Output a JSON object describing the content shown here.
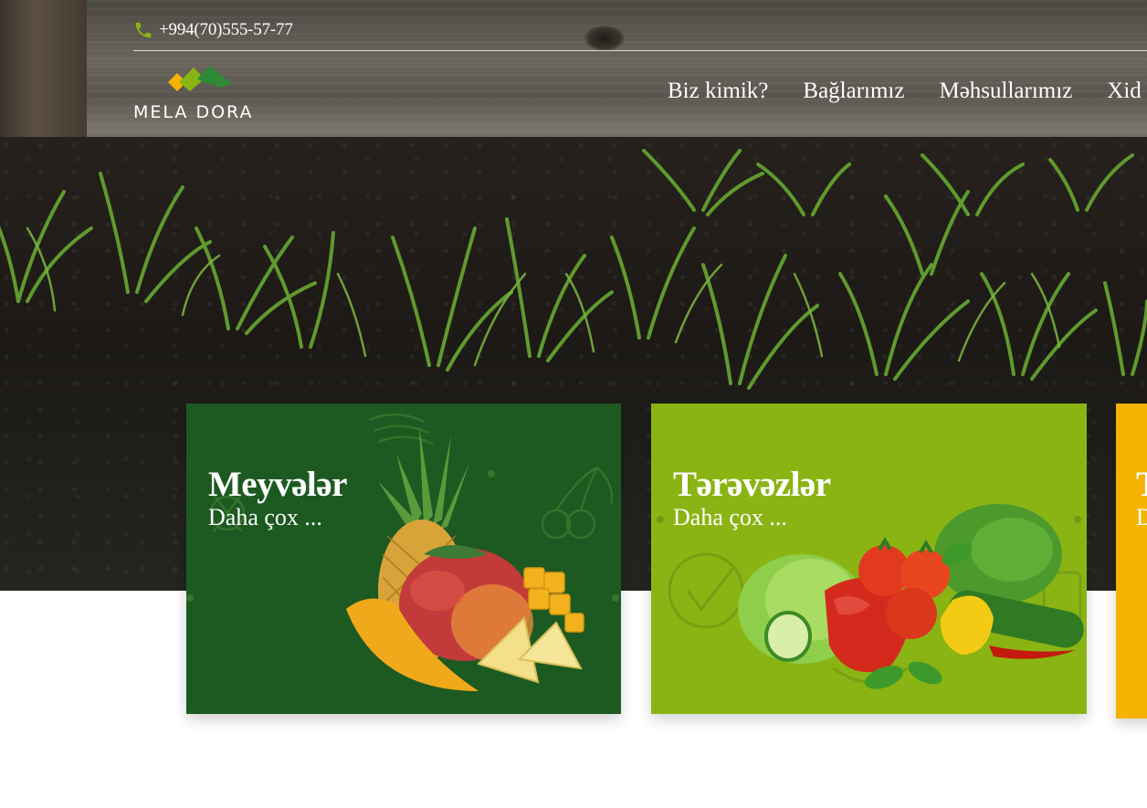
{
  "header": {
    "phone": "+994(70)555-57-77",
    "logo_text": "MELA DORA",
    "nav": [
      {
        "label": "Biz kimik?"
      },
      {
        "label": "Bağlarımız"
      },
      {
        "label": "Məhsullarımız"
      },
      {
        "label": "Xid"
      }
    ]
  },
  "cards": [
    {
      "title": "Meyvələr",
      "link": "Daha çox ...",
      "color": "#1d5a22"
    },
    {
      "title": "Tərəvəzlər",
      "link": "Daha çox ...",
      "color": "#8ab413"
    },
    {
      "title": "T",
      "link": "D",
      "color": "#f4b300"
    }
  ],
  "icons": {
    "phone": "phone-icon",
    "logo": "mela-dora-logo-mark"
  },
  "colors": {
    "accent_green": "#8ab413",
    "dark_green": "#1d5a22",
    "yellow": "#f4b300"
  }
}
